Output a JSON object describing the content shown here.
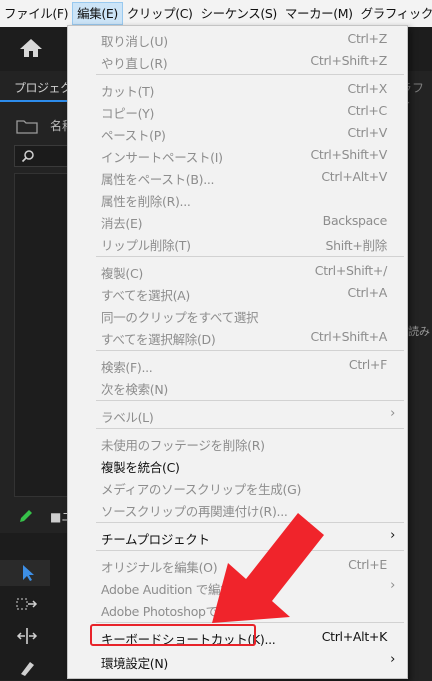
{
  "menubar": {
    "items": [
      "ファイル(F)",
      "編集(E)",
      "クリップ(C)",
      "シーケンス(S)",
      "マーカー(M)",
      "グラフィック(G)"
    ]
  },
  "panel": {
    "tab_label": "プロジェクト",
    "right_tab_fragment": "ラフィ",
    "name_header": "名称",
    "read_fragment": "読み",
    "bottom_label": "ニ"
  },
  "edit_menu": {
    "items": [
      {
        "label": "取り消し(U)",
        "shortcut": "Ctrl+Z",
        "enabled": false
      },
      {
        "label": "やり直し(R)",
        "shortcut": "Ctrl+Shift+Z",
        "enabled": false
      },
      {
        "label": "カット(T)",
        "shortcut": "Ctrl+X",
        "enabled": false
      },
      {
        "label": "コピー(Y)",
        "shortcut": "Ctrl+C",
        "enabled": false
      },
      {
        "label": "ペースト(P)",
        "shortcut": "Ctrl+V",
        "enabled": false
      },
      {
        "label": "インサートペースト(I)",
        "shortcut": "Ctrl+Shift+V",
        "enabled": false
      },
      {
        "label": "属性をペースト(B)...",
        "shortcut": "Ctrl+Alt+V",
        "enabled": false
      },
      {
        "label": "属性を削除(R)...",
        "shortcut": "",
        "enabled": false
      },
      {
        "label": "消去(E)",
        "shortcut": "Backspace",
        "enabled": false
      },
      {
        "label": "リップル削除(T)",
        "shortcut": "Shift+削除",
        "enabled": false
      },
      {
        "label": "複製(C)",
        "shortcut": "Ctrl+Shift+/",
        "enabled": false
      },
      {
        "label": "すべてを選択(A)",
        "shortcut": "Ctrl+A",
        "enabled": false
      },
      {
        "label": "同一のクリップをすべて選択",
        "shortcut": "",
        "enabled": false
      },
      {
        "label": "すべてを選択解除(D)",
        "shortcut": "Ctrl+Shift+A",
        "enabled": false
      },
      {
        "label": "検索(F)...",
        "shortcut": "Ctrl+F",
        "enabled": false
      },
      {
        "label": "次を検索(N)",
        "shortcut": "",
        "enabled": false
      },
      {
        "label": "ラベル(L)",
        "shortcut": "",
        "enabled": false,
        "submenu": true
      },
      {
        "label": "未使用のフッテージを削除(R)",
        "shortcut": "",
        "enabled": false
      },
      {
        "label": "複製を統合(C)",
        "shortcut": "",
        "enabled": true
      },
      {
        "label": "メディアのソースクリップを生成(G)",
        "shortcut": "",
        "enabled": false
      },
      {
        "label": "ソースクリップの再関連付け(R)...",
        "shortcut": "",
        "enabled": false
      },
      {
        "label": "チームプロジェクト",
        "shortcut": "",
        "enabled": true,
        "submenu": true
      },
      {
        "label": "オリジナルを編集(O)",
        "shortcut": "Ctrl+E",
        "enabled": false
      },
      {
        "label": "Adobe Audition で編集",
        "shortcut": "",
        "enabled": false,
        "submenu": true
      },
      {
        "label": "Adobe Photoshopで編集",
        "shortcut": "",
        "enabled": false
      },
      {
        "label": "キーボードショートカット(K)...",
        "shortcut": "Ctrl+Alt+K",
        "enabled": true
      },
      {
        "label": "環境設定(N)",
        "shortcut": "",
        "enabled": true,
        "submenu": true
      }
    ]
  },
  "colors": {
    "highlight": "#e8232a",
    "arrow": "#f0242b",
    "accent": "#2d8ceb"
  }
}
